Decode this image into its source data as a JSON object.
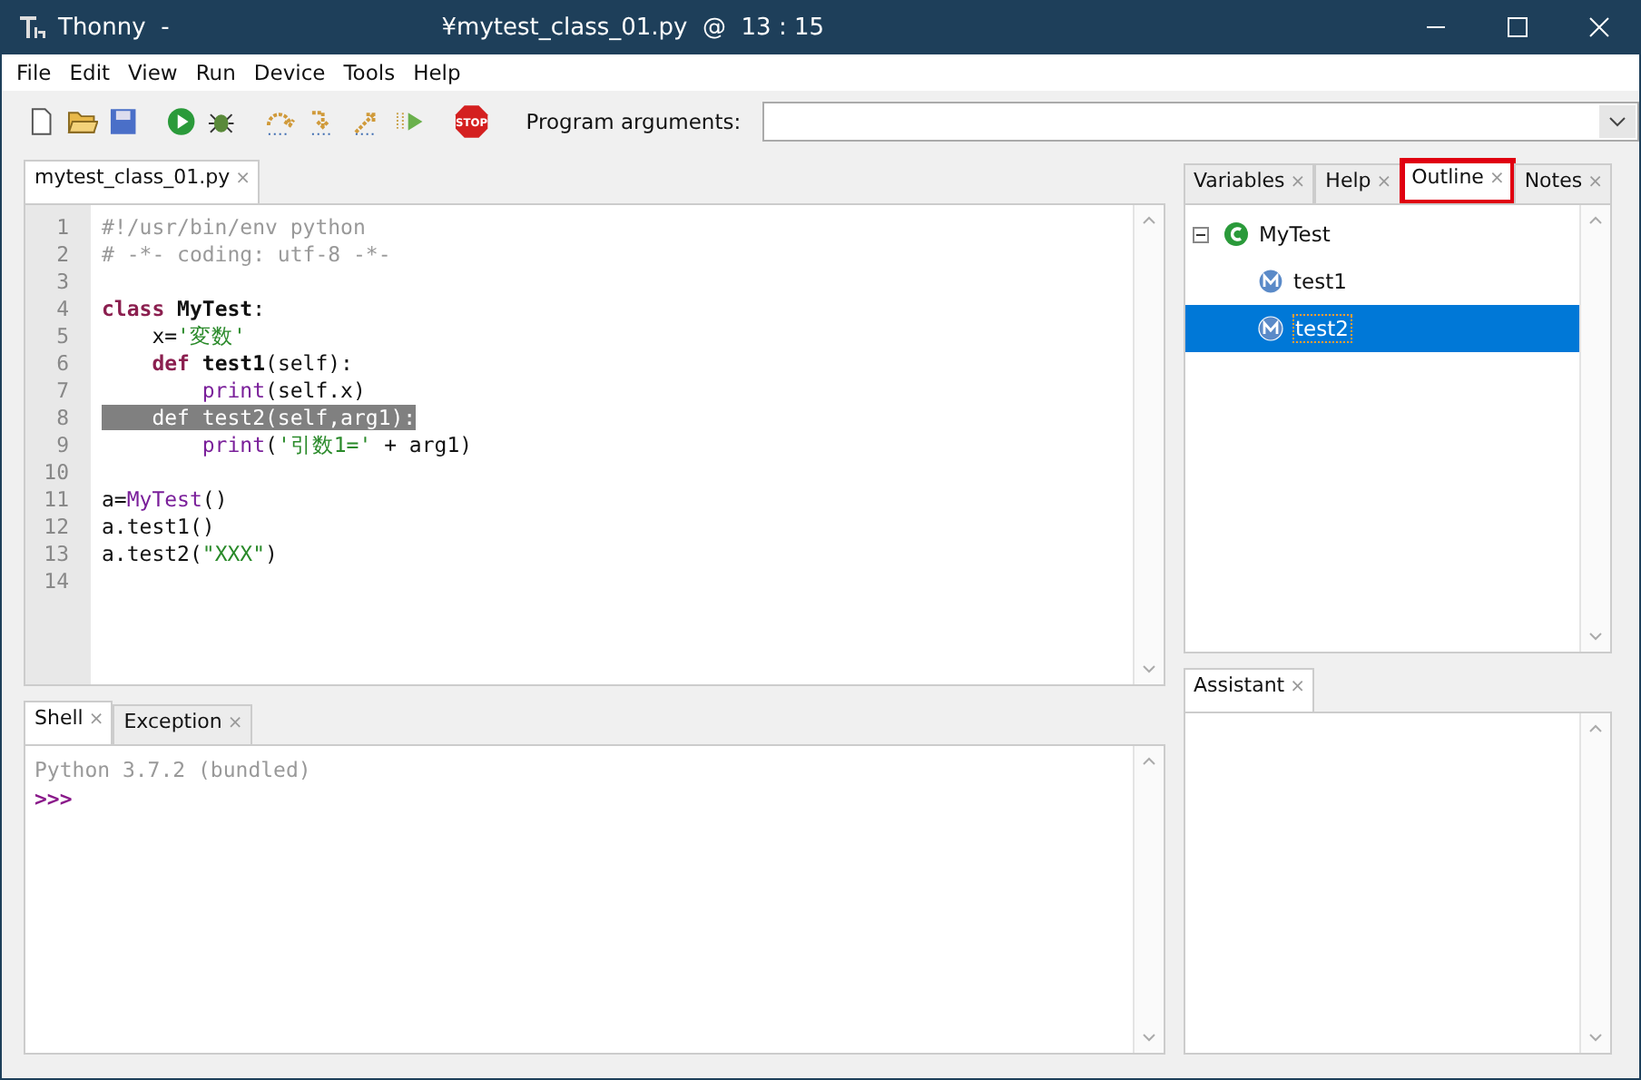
{
  "window": {
    "app": "Thonny  -",
    "title": "¥mytest_class_01.py  @  13 : 15"
  },
  "menu": [
    "File",
    "Edit",
    "View",
    "Run",
    "Device",
    "Tools",
    "Help"
  ],
  "toolbar": {
    "buttons": [
      {
        "kind": "new"
      },
      {
        "kind": "open"
      },
      {
        "kind": "save"
      },
      {
        "kind": "run"
      },
      {
        "kind": "debug"
      },
      {
        "kind": "step-over"
      },
      {
        "kind": "step-into"
      },
      {
        "kind": "step-out"
      },
      {
        "kind": "resume"
      },
      {
        "kind": "stop",
        "label": "STOP"
      }
    ],
    "args_label": "Program arguments:"
  },
  "editor": {
    "tabs": [
      {
        "label": "mytest_class_01.py",
        "close": "×",
        "selected": true
      }
    ],
    "lines": [
      {
        "number": "1",
        "tokens": [
          {
            "kind": "comment",
            "t": "#!/usr/bin/env python"
          }
        ]
      },
      {
        "number": "2",
        "tokens": [
          {
            "kind": "comment",
            "t": "# -*- coding: utf-8 -*-"
          }
        ]
      },
      {
        "number": "3"
      },
      {
        "number": "4",
        "tokens": [
          {
            "kind": "keyword",
            "t": "class "
          },
          {
            "kind": "name",
            "t": "MyTest"
          },
          {
            "kind": "plain",
            "t": ":"
          }
        ]
      },
      {
        "number": "5",
        "tokens": [
          {
            "kind": "plain",
            "t": "    x="
          },
          {
            "kind": "string",
            "t": "'変数'"
          }
        ]
      },
      {
        "number": "6",
        "tokens": [
          {
            "kind": "keyword",
            "t": "    def "
          },
          {
            "kind": "name",
            "t": "test1"
          },
          {
            "kind": "plain",
            "t": "(self):"
          }
        ]
      },
      {
        "number": "7",
        "tokens": [
          {
            "kind": "builtin",
            "t": "        print"
          },
          {
            "kind": "plain",
            "t": "(self.x)"
          }
        ]
      },
      {
        "number": "8",
        "highlighted": true,
        "tokens": [
          {
            "kind": "plain",
            "t": "    def test2(self,arg1):"
          }
        ]
      },
      {
        "number": "9",
        "tokens": [
          {
            "kind": "builtin",
            "t": "        print"
          },
          {
            "kind": "plain",
            "t": "("
          },
          {
            "kind": "string",
            "t": "'引数1='"
          },
          {
            "kind": "plain",
            "t": " + arg1)"
          }
        ]
      },
      {
        "number": "10"
      },
      {
        "number": "11",
        "tokens": [
          {
            "kind": "plain",
            "t": "a="
          },
          {
            "kind": "builtin",
            "t": "MyTest"
          },
          {
            "kind": "plain",
            "t": "()"
          }
        ]
      },
      {
        "number": "12",
        "tokens": [
          {
            "kind": "plain",
            "t": "a.test1()"
          }
        ]
      },
      {
        "number": "13",
        "tokens": [
          {
            "kind": "plain",
            "t": "a.test2("
          },
          {
            "kind": "string",
            "t": "\"XXX\""
          },
          {
            "kind": "plain",
            "t": ")"
          }
        ]
      },
      {
        "number": "14"
      }
    ]
  },
  "shell": {
    "tabs": [
      {
        "label": "Shell",
        "close": "×",
        "selected": true
      },
      {
        "label": "Exception",
        "close": "×",
        "selected": false
      }
    ],
    "banner": "Python 3.7.2 (bundled)",
    "prompt": ">>>"
  },
  "side_tabs": [
    {
      "label": "Variables",
      "close": "×",
      "selected": false,
      "marked": false
    },
    {
      "label": "Help",
      "close": "×",
      "selected": false,
      "marked": false
    },
    {
      "label": "Outline",
      "close": "×",
      "selected": true,
      "marked": true
    },
    {
      "label": "Notes",
      "close": "×",
      "selected": false,
      "marked": false
    }
  ],
  "outline": [
    {
      "name": "MyTest",
      "kind": "class",
      "expanded": true,
      "selected": false,
      "children": [
        {
          "name": "test1",
          "kind": "method",
          "selected": false
        },
        {
          "name": "test2",
          "kind": "method",
          "selected": true
        }
      ]
    }
  ],
  "assistant": {
    "tabs": [
      {
        "label": "Assistant",
        "close": "×",
        "selected": true
      }
    ]
  }
}
